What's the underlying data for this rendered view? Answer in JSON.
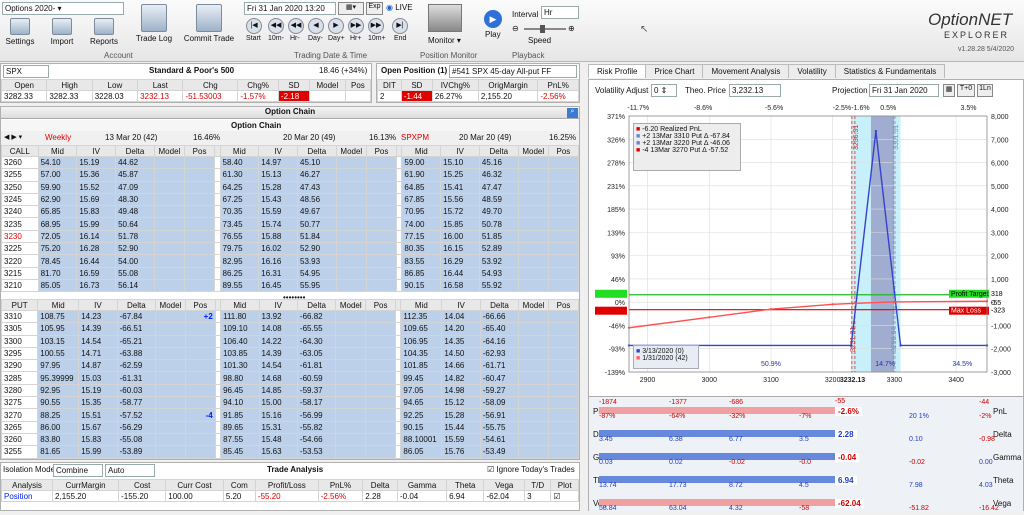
{
  "ribbon": {
    "account_select": "Options 2020-",
    "buttons": [
      "Settings",
      "Import",
      "Reports",
      "Trade Log",
      "Commit Trade"
    ],
    "group_account": "Account",
    "date": "Fri 31 Jan 2020 13:20",
    "exp": "Exp",
    "live": "LIVE",
    "nav": [
      "Start",
      "10m-",
      "Hr-",
      "Day-",
      "Day+",
      "Hr+",
      "10m+",
      "End"
    ],
    "group_td": "Trading Date & Time",
    "monitor": "Monitor",
    "group_pm": "Position Monitor",
    "play": "Play",
    "interval_label": "Interval",
    "interval_value": "Hr",
    "speed": "Speed",
    "group_playback": "Playback",
    "logo1": "OptionNET",
    "logo2": "EXPLORER",
    "version": "v1.28.28  5/4/2020"
  },
  "underlying": {
    "symbol": "SPX",
    "title": "Standard & Poor's 500",
    "change_note": "18.46 (+34%)",
    "headers": [
      "Open",
      "High",
      "Low",
      "Last",
      "Chg",
      "Chg%",
      "SD",
      "Model",
      "Pos"
    ],
    "values": [
      "3282.33",
      "3282.33",
      "3228.03",
      "3232.13",
      "-51.53003",
      "-1.57%",
      "-2.18",
      "",
      ""
    ]
  },
  "position": {
    "title": "Open Position (1)",
    "name": "#541 SPX 45-day All-put FF",
    "headers": [
      "DIT",
      "SD",
      "IVChg%",
      "OrigMargin",
      "PnL%"
    ],
    "values": [
      "2",
      "-1.44",
      "26.27%",
      "2,155.20",
      "-2.56%"
    ]
  },
  "chain": {
    "title": "Option Chain",
    "sub_title": "Option Chain",
    "col_headers": [
      "Mid",
      "IV",
      "Delta",
      "Model",
      "Pos"
    ],
    "exps": [
      {
        "name": "Weekly",
        "date": "13 Mar 20 (42)",
        "iv": "16.46%"
      },
      {
        "name": "",
        "date": "20 Mar 20 (49)",
        "iv": "16.13%"
      },
      {
        "name": "SPXPM",
        "date": "20 Mar 20 (49)",
        "iv": "16.25%"
      }
    ],
    "call_strikes": [
      "3260",
      "3255",
      "3250",
      "3245",
      "3240",
      "3235",
      "3230",
      "3225",
      "3220",
      "3215",
      "3210"
    ],
    "calls": [
      [
        [
          "54.10",
          "15.19",
          "44.62"
        ],
        [
          "57.00",
          "15.36",
          "45.87"
        ],
        [
          "59.90",
          "15.52",
          "47.09"
        ],
        [
          "62.90",
          "15.69",
          "48.30"
        ],
        [
          "65.85",
          "15.83",
          "49.48"
        ],
        [
          "68.95",
          "15.99",
          "50.64"
        ],
        [
          "72.05",
          "16.14",
          "51.78"
        ],
        [
          "75.20",
          "16.28",
          "52.90"
        ],
        [
          "78.45",
          "16.44",
          "54.00"
        ],
        [
          "81.70",
          "16.59",
          "55.08"
        ],
        [
          "85.05",
          "16.73",
          "56.14"
        ]
      ],
      [
        [
          "58.40",
          "14.97",
          "45.10"
        ],
        [
          "61.30",
          "15.13",
          "46.27"
        ],
        [
          "64.25",
          "15.28",
          "47.43"
        ],
        [
          "67.25",
          "15.43",
          "48.56"
        ],
        [
          "70.35",
          "15.59",
          "49.67"
        ],
        [
          "73.45",
          "15.74",
          "50.77"
        ],
        [
          "76.55",
          "15.88",
          "51.84"
        ],
        [
          "79.75",
          "16.02",
          "52.90"
        ],
        [
          "82.95",
          "16.16",
          "53.93"
        ],
        [
          "86.25",
          "16.31",
          "54.95"
        ],
        [
          "89.55",
          "16.45",
          "55.95"
        ]
      ],
      [
        [
          "59.00",
          "15.10",
          "45.16"
        ],
        [
          "61.90",
          "15.25",
          "46.32"
        ],
        [
          "64.85",
          "15.41",
          "47.47"
        ],
        [
          "67.85",
          "15.56",
          "48.59"
        ],
        [
          "70.95",
          "15.72",
          "49.70"
        ],
        [
          "74.00",
          "15.85",
          "50.78"
        ],
        [
          "77.15",
          "16.00",
          "51.85"
        ],
        [
          "80.35",
          "16.15",
          "52.89"
        ],
        [
          "83.55",
          "16.29",
          "53.92"
        ],
        [
          "86.85",
          "16.44",
          "54.93"
        ],
        [
          "90.15",
          "16.58",
          "55.92"
        ]
      ]
    ],
    "put_strikes": [
      "3310",
      "3305",
      "3300",
      "3295",
      "3290",
      "3285",
      "3280",
      "3275",
      "3270",
      "3265",
      "3260",
      "3255"
    ],
    "puts": [
      [
        [
          "108.75",
          "14.23",
          "-67.84",
          "+2"
        ],
        [
          "105.95",
          "14.39",
          "-66.51",
          ""
        ],
        [
          "103.15",
          "14.54",
          "-65.21",
          ""
        ],
        [
          "100.55",
          "14.71",
          "-63.88",
          ""
        ],
        [
          "97.95",
          "14.87",
          "-62.59",
          ""
        ],
        [
          "95.39999",
          "15.03",
          "-61.31",
          ""
        ],
        [
          "92.95",
          "15.19",
          "-60.03",
          ""
        ],
        [
          "90.55",
          "15.35",
          "-58.77",
          ""
        ],
        [
          "88.25",
          "15.51",
          "-57.52",
          "-4"
        ],
        [
          "86.00",
          "15.67",
          "-56.29",
          ""
        ],
        [
          "83.80",
          "15.83",
          "-55.08",
          ""
        ],
        [
          "81.65",
          "15.99",
          "-53.89",
          ""
        ]
      ],
      [
        [
          "111.80",
          "13.92",
          "-66.82",
          ""
        ],
        [
          "109.10",
          "14.08",
          "-65.55",
          ""
        ],
        [
          "106.40",
          "14.22",
          "-64.30",
          ""
        ],
        [
          "103.85",
          "14.39",
          "-63.05",
          ""
        ],
        [
          "101.30",
          "14.54",
          "-61.81",
          ""
        ],
        [
          "98.80",
          "14.68",
          "-60.59",
          ""
        ],
        [
          "96.45",
          "14.85",
          "-59.37",
          ""
        ],
        [
          "94.10",
          "15.00",
          "-58.17",
          ""
        ],
        [
          "91.85",
          "15.16",
          "-56.99",
          ""
        ],
        [
          "89.65",
          "15.31",
          "-55.82",
          ""
        ],
        [
          "87.55",
          "15.48",
          "-54.66",
          ""
        ],
        [
          "85.45",
          "15.63",
          "-53.53",
          ""
        ]
      ],
      [
        [
          "112.35",
          "14.04",
          "-66.66",
          ""
        ],
        [
          "109.65",
          "14.20",
          "-65.40",
          ""
        ],
        [
          "106.95",
          "14.35",
          "-64.16",
          ""
        ],
        [
          "104.35",
          "14.50",
          "-62.93",
          ""
        ],
        [
          "101.85",
          "14.66",
          "-61.71",
          ""
        ],
        [
          "99.45",
          "14.82",
          "-60.47",
          ""
        ],
        [
          "97.05",
          "14.98",
          "-59.27",
          ""
        ],
        [
          "94.65",
          "15.12",
          "-58.09",
          ""
        ],
        [
          "92.25",
          "15.28",
          "-56.91",
          ""
        ],
        [
          "90.15",
          "15.44",
          "-55.75",
          ""
        ],
        [
          "88.10001",
          "15.59",
          "-54.61",
          ""
        ],
        [
          "86.05",
          "15.76",
          "-53.49",
          ""
        ]
      ]
    ]
  },
  "trade": {
    "title": "Trade Analysis",
    "iso_label": "Isolation Mode",
    "iso_value": "Combine",
    "auto": "Auto",
    "ignore": "Ignore Today's Trades",
    "headers": [
      "Analysis",
      "CurrMargin",
      "Cost",
      "Curr Cost",
      "Com",
      "Profit/Loss",
      "PnL%",
      "Delta",
      "Gamma",
      "Theta",
      "Vega",
      "T/D",
      "Plot"
    ],
    "row": [
      "Position",
      "2,155.20",
      "-155.20",
      "100.00",
      "5.20",
      "-55.20",
      "-2.56%",
      "2.28",
      "-0.04",
      "6.94",
      "-62.04",
      "3",
      ""
    ]
  },
  "tabs": [
    "Risk Profile",
    "Price Chart",
    "Movement Analysis",
    "Volatility",
    "Statistics & Fundamentals"
  ],
  "risk": {
    "vol_adj_label": "Volatility Adjust",
    "vol_adj": "0",
    "theo_label": "Theo. Price",
    "theo": "3,232.13",
    "proj_label": "Projection",
    "proj": "Fri 31 Jan 2020",
    "t0": "T+0",
    "one_ln": "1Ln",
    "pct_top": [
      "-11.7%",
      "-8.6%",
      "-5.6%",
      "-2.5%",
      "-1.6%",
      "0.5%",
      "3.5%"
    ],
    "legend": [
      "-6.20 Realized PnL",
      "+2 13Mar 3310 Put Δ -67.84",
      "+2 13Mar 3220 Put Δ -46.06",
      "-4 13Mar 3270 Put Δ -57.52"
    ],
    "legend_bottom": [
      "3/13/2020 (0)",
      "1/31/2020 (42)"
    ],
    "y_left": [
      "371%",
      "326%",
      "278%",
      "231%",
      "185%",
      "139%",
      "93%",
      "46%",
      "0%",
      "-46%",
      "-93%",
      "-139%"
    ],
    "y_right": [
      "8,000",
      "7,000",
      "6,000",
      "5,000",
      "4,000",
      "3,000",
      "2,000",
      "1,000",
      "0",
      "-1,000",
      "-2,000",
      "-3,000"
    ],
    "x_ticks": [
      "2900",
      "3000",
      "3100",
      "3200",
      "3232.13",
      "3300",
      "3400"
    ],
    "profit_target": "Profit Target",
    "profit_target_val": "318",
    "max_loss": "Max Loss",
    "max_loss_val": "-323",
    "pnl_small": "-55",
    "probs": [
      "50.9%",
      "14.7%",
      "34.5%"
    ],
    "vlines": [
      "3236.31",
      "3301.31",
      "3231.31",
      "3298.84"
    ],
    "chart_data": {
      "type": "line",
      "x_range": [
        2870,
        3450
      ],
      "y_range": [
        -3000,
        8000
      ],
      "series": [
        {
          "name": "3/13/2020 (0)",
          "x": [
            2870,
            3230,
            3270,
            3310,
            3450
          ],
          "y": [
            -1860,
            -1860,
            7350,
            -1860,
            -1860
          ]
        },
        {
          "name": "1/31/2020 (42)",
          "x": [
            2870,
            3000,
            3100,
            3200,
            3232,
            3300,
            3450
          ],
          "y": [
            -1100,
            -650,
            -300,
            -90,
            -55,
            10,
            40
          ]
        }
      ]
    }
  },
  "greeks": {
    "rows": [
      {
        "label": "PnL",
        "vals": [
          "-87%",
          "-64%",
          "-32%",
          "-7%",
          "-2.6%",
          "20\n1%",
          "-2%"
        ],
        "sub": [
          "-1874",
          "-1377",
          "-686",
          "",
          "-55",
          "",
          "-44"
        ]
      },
      {
        "label": "Delta",
        "vals": [
          "3.45",
          "6.38",
          "6.77",
          "3.5",
          "2.28",
          "0.10",
          "-0.98"
        ]
      },
      {
        "label": "Gamma",
        "vals": [
          "0.03",
          "0.02",
          "-0.02",
          "-0.0",
          "-0.04",
          "-0.02",
          "0.00"
        ]
      },
      {
        "label": "Theta",
        "vals": [
          "13.74",
          "17.73",
          "8.72",
          "4.5",
          "6.94",
          "7.98",
          "4.03"
        ]
      },
      {
        "label": "Vega",
        "vals": [
          "58.84",
          "63.04",
          "4.32",
          "-58",
          "-62.04",
          "-51.82",
          "-16.42"
        ]
      }
    ]
  }
}
